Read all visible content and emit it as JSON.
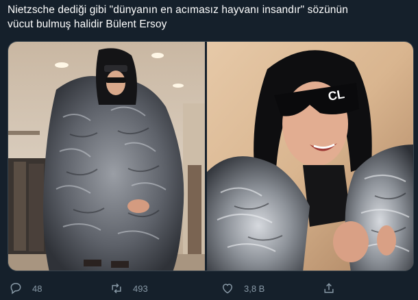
{
  "tweet": {
    "text_line_1": "Nietzsche dediği gibi \"dünyanın en acımasız hayvanı insandır\" sözünün",
    "text_line_2": "vücut bulmuş halidir Bülent Ersoy"
  },
  "media": {
    "photos": [
      {
        "description_icon": "photo-person-fur-coat-full"
      },
      {
        "description_icon": "photo-person-fur-coat-closeup"
      }
    ],
    "sunglasses_text": "CL"
  },
  "actions": {
    "reply": {
      "icon": "reply-icon",
      "count": "48"
    },
    "retweet": {
      "icon": "retweet-icon",
      "count": "493"
    },
    "like": {
      "icon": "heart-icon",
      "count": "3,8 B"
    },
    "share": {
      "icon": "share-icon"
    }
  },
  "colors": {
    "background": "#15202b",
    "text": "#ffffff",
    "muted": "#8899a6",
    "border": "#38444d"
  }
}
